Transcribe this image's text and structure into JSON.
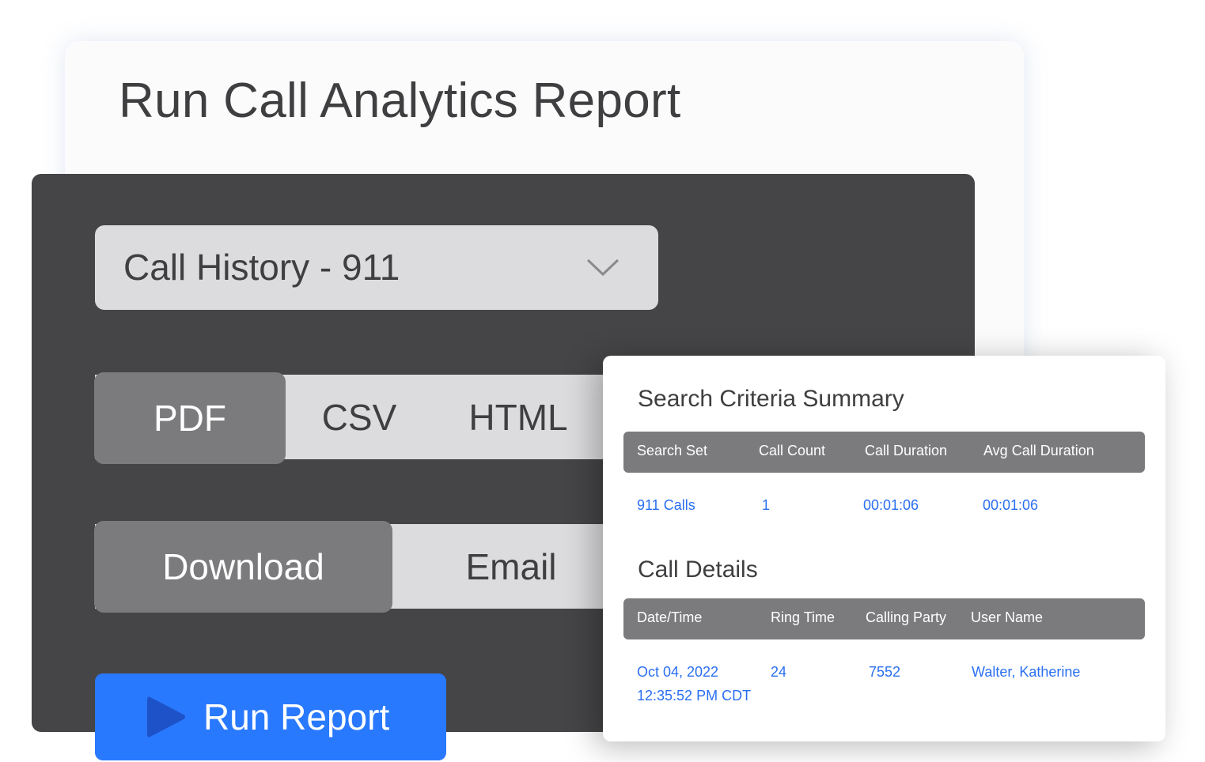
{
  "page": {
    "title": "Run Call Analytics Report"
  },
  "report_select": {
    "value": "Call History - 911"
  },
  "formats": {
    "options": [
      "PDF",
      "CSV",
      "HTML"
    ],
    "selected": "PDF"
  },
  "delivery": {
    "options": [
      "Download",
      "Email"
    ],
    "selected": "Download"
  },
  "run_button": {
    "label": "Run Report"
  },
  "summary": {
    "title": "Search Criteria Summary",
    "columns": [
      "Search Set",
      "Call Count",
      "Call Duration",
      "Avg Call Duration"
    ],
    "rows": [
      [
        "911 Calls",
        "1",
        "00:01:06",
        "00:01:06"
      ]
    ]
  },
  "details": {
    "title": "Call Details",
    "columns": [
      "Date/Time",
      "Ring Time",
      "Calling Party",
      "User Name"
    ],
    "rows": [
      {
        "date": "Oct 04, 2022",
        "time": "12:35:52 PM CDT",
        "ring_time": "24",
        "calling_party": "7552",
        "user_name": "Walter, Katherine"
      }
    ]
  },
  "colors": {
    "accent": "#2979fe",
    "panel": "#454446",
    "segment_active": "#7b7a7d",
    "segment_inactive": "#dcdbdd",
    "link_text": "#2a6ff0"
  }
}
